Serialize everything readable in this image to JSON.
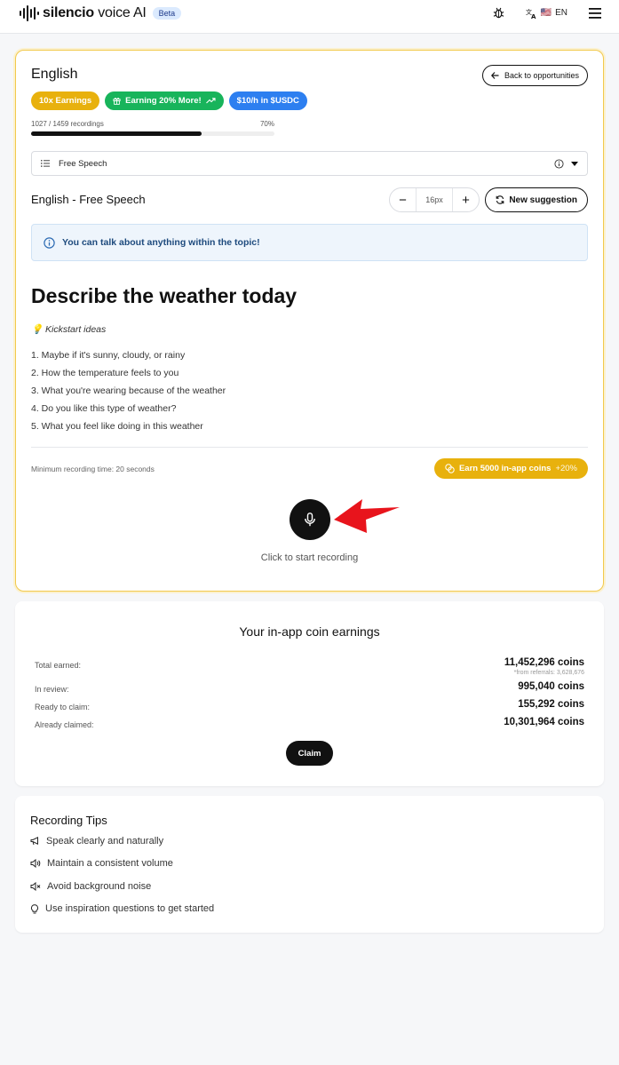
{
  "header": {
    "logo_bold": "silencio",
    "logo_rest": " voice AI",
    "beta": "Beta",
    "lang_flag": "🇺🇸",
    "lang_code": "EN"
  },
  "main": {
    "language": "English",
    "back_label": "Back to opportunities",
    "badges": [
      "10x Earnings",
      "Earning 20% More!",
      "$10/h in $USDC"
    ],
    "recordings": "1027 / 1459 recordings",
    "progress_pct": "70%",
    "progress_fraction": 0.7,
    "select_value": "Free Speech",
    "topic_title": "English - Free Speech",
    "font_size": "16px",
    "new_suggestion": "New suggestion",
    "info": "You can talk about anything within the topic!",
    "prompt": "Describe the weather today",
    "kickstart": "Kickstart ideas",
    "ideas": [
      "1. Maybe if it's sunny, cloudy, or rainy",
      "2. How the temperature feels to you",
      "3. What you're wearing because of the weather",
      "4. Do you like this type of weather?",
      "5. What you feel like doing in this weather"
    ],
    "min_time": "Minimum recording time: 20 seconds",
    "earn_label": "Earn 5000 in-app coins",
    "earn_bonus": "+20%",
    "click_to_record": "Click to start recording"
  },
  "earnings": {
    "title": "Your in-app coin earnings",
    "total_label": "Total earned:",
    "total_value": "11,452,296 coins",
    "referrals": "*from referrals: 3,628,676",
    "review_label": "In review:",
    "review_value": "995,040 coins",
    "ready_label": "Ready to claim:",
    "ready_value": "155,292 coins",
    "claimed_label": "Already claimed:",
    "claimed_value": "10,301,964 coins",
    "claim_button": "Claim"
  },
  "tips": {
    "title": "Recording Tips",
    "items": [
      "Speak clearly and naturally",
      "Maintain a consistent volume",
      "Avoid background noise",
      "Use inspiration questions to get started"
    ],
    "icons": [
      "megaphone-icon",
      "volume-icon",
      "mute-icon",
      "lightbulb-icon"
    ]
  },
  "colors": {
    "accent_yellow": "#e8b10d",
    "accent_green": "#18b45b",
    "accent_blue": "#2d7ff0",
    "arrow_red": "#e8141c"
  }
}
